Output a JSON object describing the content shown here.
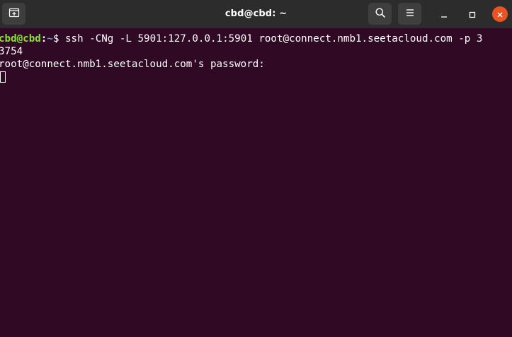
{
  "window": {
    "title": "cbd@cbd: ~"
  },
  "titlebar": {
    "new_tab_icon": "new-tab-icon",
    "search_icon": "search-icon",
    "menu_icon": "hamburger-menu-icon",
    "minimize_icon": "minimize-icon",
    "maximize_icon": "maximize-icon",
    "close_icon": "close-icon"
  },
  "terminal": {
    "prompt_user_host": "cbd@cbd",
    "prompt_colon": ":",
    "prompt_path": "~",
    "prompt_dollar": "$ ",
    "command_line_1": "ssh -CNg -L 5901:127.0.0.1:5901 root@connect.nmb1.seetacloud.com -p 3",
    "command_line_2": "3754",
    "password_prompt": "root@connect.nmb1.seetacloud.com's password: "
  },
  "colors": {
    "background": "#300a24",
    "titlebar": "#2c2c2c",
    "prompt_user": "#8ae234",
    "prompt_path": "#729fcf",
    "close_button": "#e95420"
  }
}
